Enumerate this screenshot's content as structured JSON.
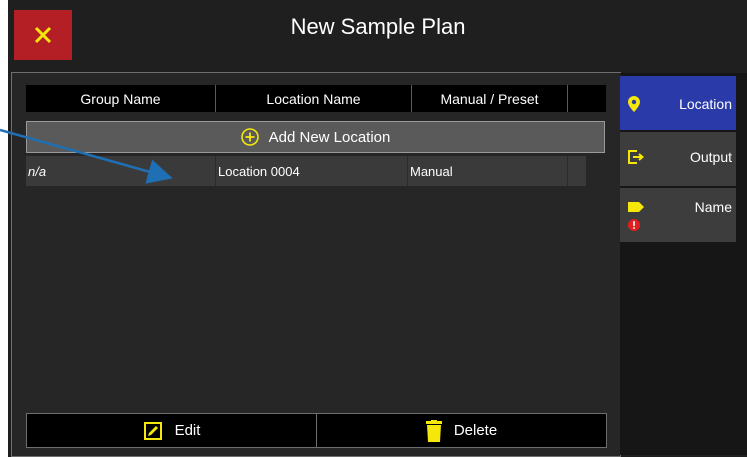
{
  "window": {
    "title": "New Sample Plan",
    "close_icon": "close-x-icon"
  },
  "table": {
    "columns": [
      "Group Name",
      "Location Name",
      "Manual / Preset"
    ],
    "add_label": "Add New Location",
    "rows": [
      {
        "group": "n/a",
        "location": "Location 0004",
        "mode": "Manual"
      }
    ]
  },
  "actions": {
    "edit_label": "Edit",
    "delete_label": "Delete"
  },
  "sidebar": {
    "items": [
      {
        "label": "Location",
        "icon": "map-pin-icon",
        "active": true
      },
      {
        "label": "Output",
        "icon": "export-icon",
        "active": false
      },
      {
        "label": "Name",
        "icon": "tag-icon",
        "active": false,
        "warning": true
      }
    ]
  },
  "colors": {
    "accent_yellow": "#f5e70a",
    "close_red": "#b41f26",
    "active_blue": "#2a3aa8",
    "arrow_blue": "#1f6fb5",
    "warning_red": "#e02020"
  }
}
